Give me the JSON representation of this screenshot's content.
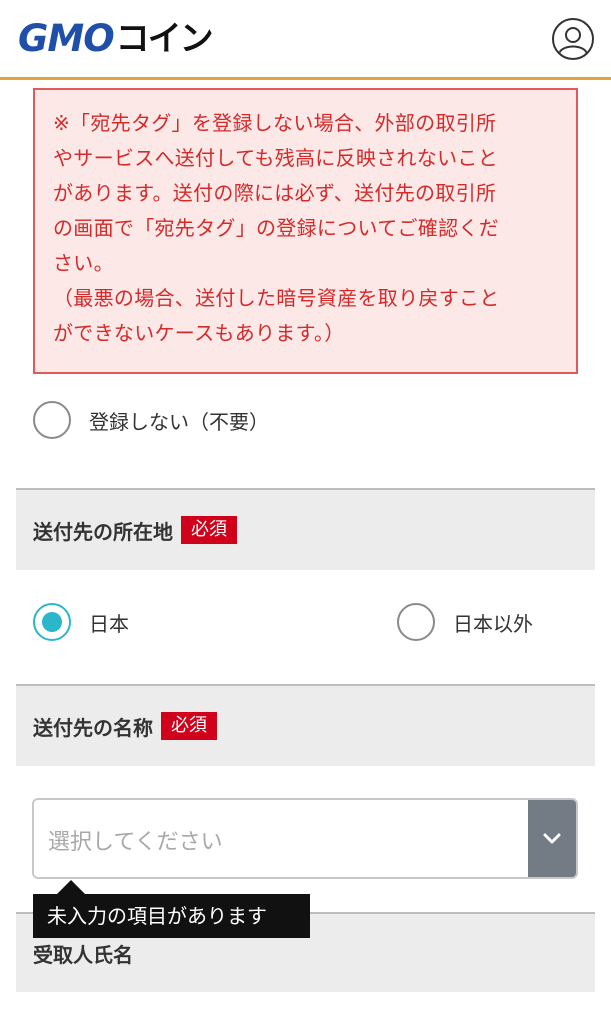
{
  "header": {
    "logo_gmo": "GMO",
    "logo_coin": "コイン",
    "user_icon": "user-icon"
  },
  "warning": {
    "lines": [
      "※「宛先タグ」を登録しない場合、外部の取引所",
      "やサービスへ送付しても残高に反映されないこと",
      "があります。送付の際には必ず、送付先の取引所",
      "の画面で「宛先タグ」の登録についてご確認くだ",
      "さい。",
      "（最悪の場合、送付した暗号資産を取り戻すこと",
      "ができないケースもあります。）"
    ]
  },
  "tag_option": {
    "label": "登録しない（不要）",
    "checked": false
  },
  "location_section": {
    "title": "送付先の所在地",
    "badge": "必須",
    "options": [
      {
        "label": "日本",
        "checked": true
      },
      {
        "label": "日本以外",
        "checked": false
      }
    ]
  },
  "name_section": {
    "title": "送付先の名称",
    "badge": "必須",
    "select_placeholder": "選択してください",
    "error_tooltip": "未入力の項目があります"
  },
  "recipient_section": {
    "title": "受取人氏名"
  },
  "colors": {
    "header_border": "#e8a23a",
    "logo_blue": "#1f4fa8",
    "warning_text": "#d42a2a",
    "warning_bg": "#fde8e8",
    "radio_checked": "#2bb6cc",
    "badge_red": "#d0021b"
  }
}
